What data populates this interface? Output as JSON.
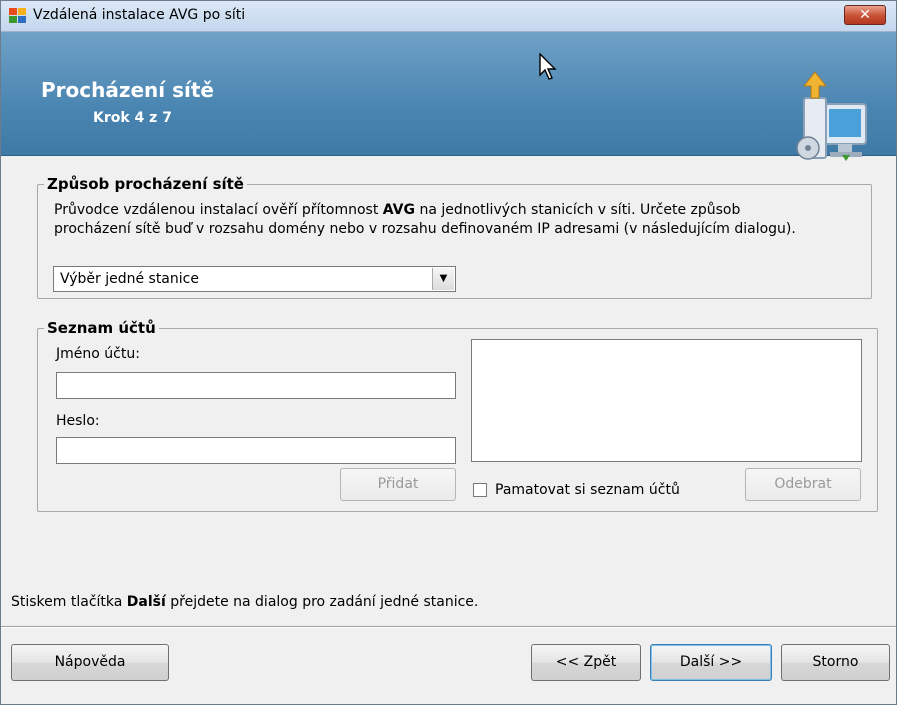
{
  "window": {
    "title": "Vzdálená instalace AVG po síti",
    "close_label": "✕"
  },
  "banner": {
    "title": "Procházení sítě",
    "step": "Krok 4 z 7"
  },
  "browse_group": {
    "legend": "Způsob procházení sítě",
    "desc_line1_before": "Průvodce vzdálenou instalací ověří přítomnost ",
    "desc_line1_bold": "AVG",
    "desc_line1_after": " na jednotlivých stanicích v síti. Určete způsob",
    "desc_line2": "procházení sítě buď v rozsahu domény nebo v rozsahu definovaném IP adresami (v následujícím dialogu).",
    "select_value": "Výběr jedné stanice"
  },
  "accounts_group": {
    "legend": "Seznam účtů",
    "account_name_label": "Jméno účtu:",
    "account_name_value": "",
    "password_label": "Heslo:",
    "password_value": "",
    "add_label": "Přidat",
    "remember_label": "Pamatovat si seznam účtů",
    "remember_checked": false,
    "remove_label": "Odebrat"
  },
  "hint": {
    "before": "Stiskem tlačítka ",
    "bold": "Další",
    "after": " přejdete na dialog pro zadání jedné stanice."
  },
  "footer": {
    "help_label": "Nápověda",
    "back_label": "<< Zpět",
    "next_label": "Další >>",
    "cancel_label": "Storno"
  }
}
